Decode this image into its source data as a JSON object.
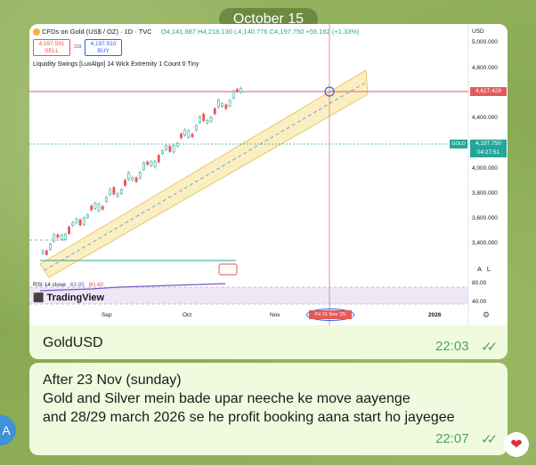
{
  "date_separator": "October 15",
  "chart": {
    "title": "CFDs on Gold (US$ / OZ) · 1D · TVC",
    "ohlc": "O4,141.887 H4,218.130 L4,140.776 C4,197.750 +55.162 (+1.33%)",
    "sell_price": "4,197.591",
    "sell_label": "SELL",
    "spread": "319",
    "buy_price": "4,197.910",
    "buy_label": "BUY",
    "indicator": "Liquidity Swings [LuxAlgo] 14 Wick Extremity 1 Count 0 Tiny",
    "currency": "USD",
    "y_ticks": [
      "5,000.000",
      "4,800.000",
      "4,400.000",
      "4,000.000",
      "3,800.000",
      "3,600.000",
      "3,400.000"
    ],
    "red_level": "4,617.429",
    "gold_label": "GOLD",
    "gold_price": "4,197.750",
    "countdown": "04:27:51",
    "x_ticks": [
      "Sep",
      "Oct",
      "Nov",
      "2026"
    ],
    "x_highlight": "Fri 21 Nov '25",
    "rsi_label": "RSI 14 close",
    "rsi_v1": "83.85",
    "rsi_v2": "80.40",
    "rsi_upper": "80.00",
    "rsi_lower": "40.00",
    "scale_btns": "A   L",
    "brand": "TradingView",
    "colors": {
      "up": "#26a69a",
      "down": "#ef5350",
      "channel": "#f7e9b0",
      "red_line": "#e05c5c",
      "rsi": "#7e57c2"
    }
  },
  "message1": {
    "text": "GoldUSD",
    "time": "22:03"
  },
  "message2": {
    "lines": [
      "After 23 Nov (sunday)",
      "Gold and Silver mein bade upar neeche ke move aayenge",
      "and 28/29 march 2026 se he profit booking aana start ho jayegee"
    ],
    "time": "22:07"
  },
  "avatar_letter": "A",
  "reaction": "heart"
}
